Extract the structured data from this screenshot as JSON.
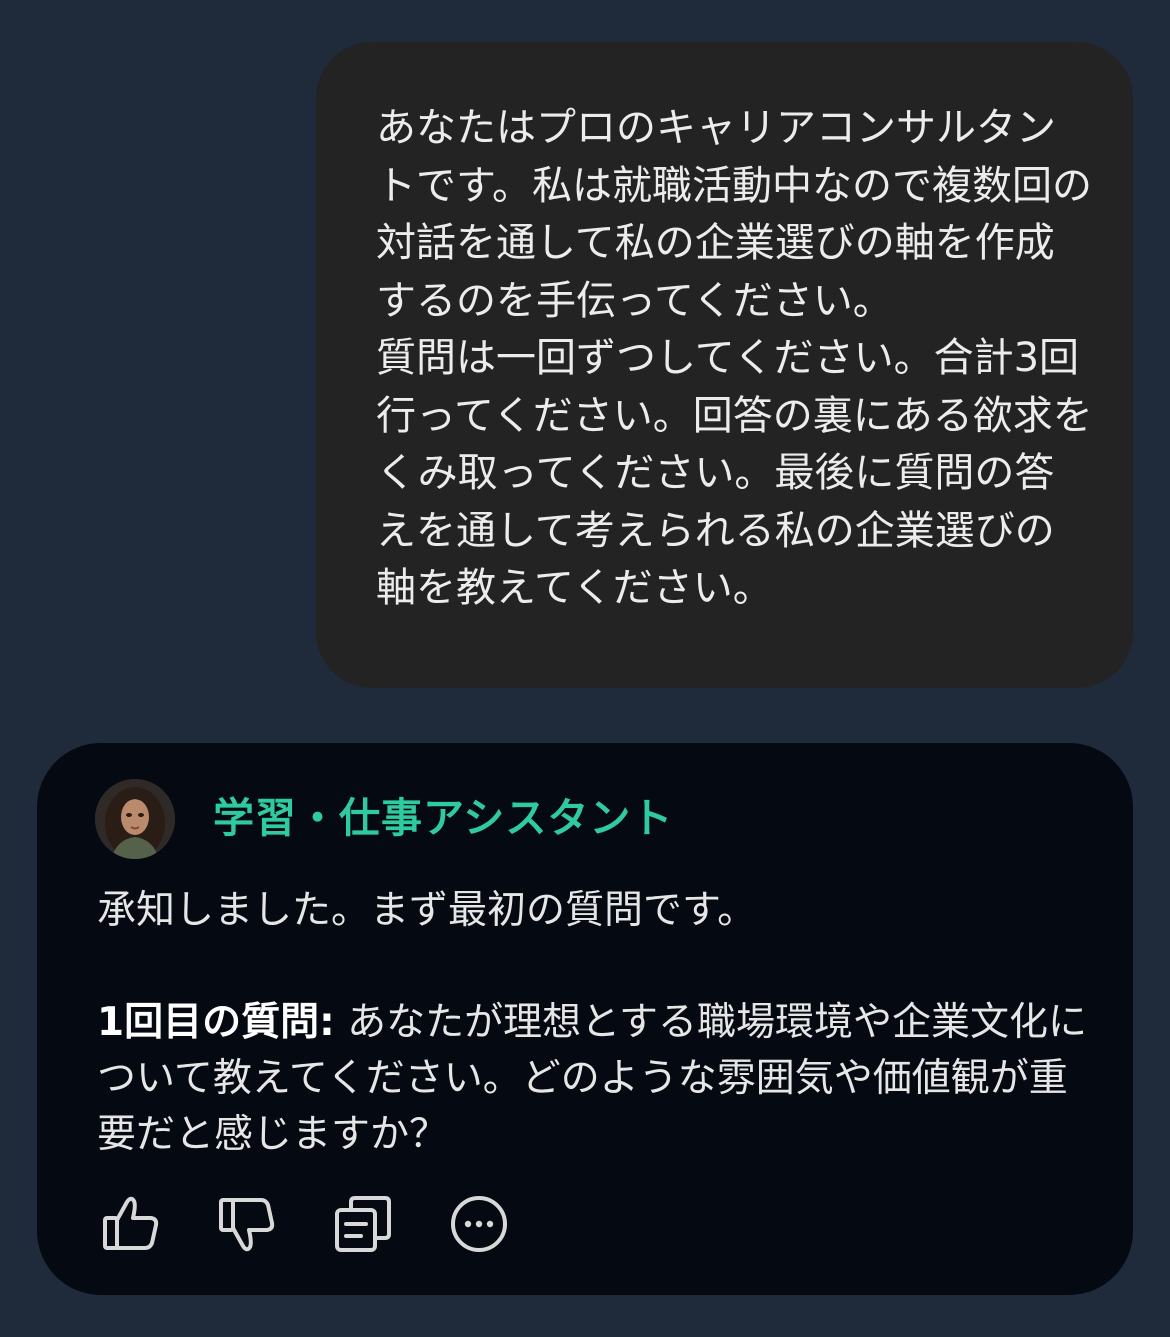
{
  "user_message": {
    "text": "あなたはプロのキャリアコンサルタントです。私は就職活動中なので複数回の対話を通して私の企業選びの軸を作成するのを手伝ってください。\n質問は一回ずつしてください。合計3回行ってください。回答の裏にある欲求をくみ取ってください。最後に質問の答えを通して考えられる私の企業選びの軸を教えてください。"
  },
  "assistant": {
    "name": "学習・仕事アシスタント",
    "intro": "承知しました。まず最初の質問です。",
    "question_label": "1回目の質問:",
    "question_text": " あなたが理想とする職場環境や企業文化について教えてください。どのような雰囲気や価値観が重要だと感じますか？"
  },
  "actions": {
    "like": "thumbs-up-icon",
    "dislike": "thumbs-down-icon",
    "copy": "copy-icon",
    "more": "more-icon"
  },
  "colors": {
    "page_bg": "#1f2a3b",
    "user_bubble": "#232323",
    "assistant_card": "#040912",
    "assistant_name": "#2fcaa0",
    "icon": "#d8d8d8"
  }
}
